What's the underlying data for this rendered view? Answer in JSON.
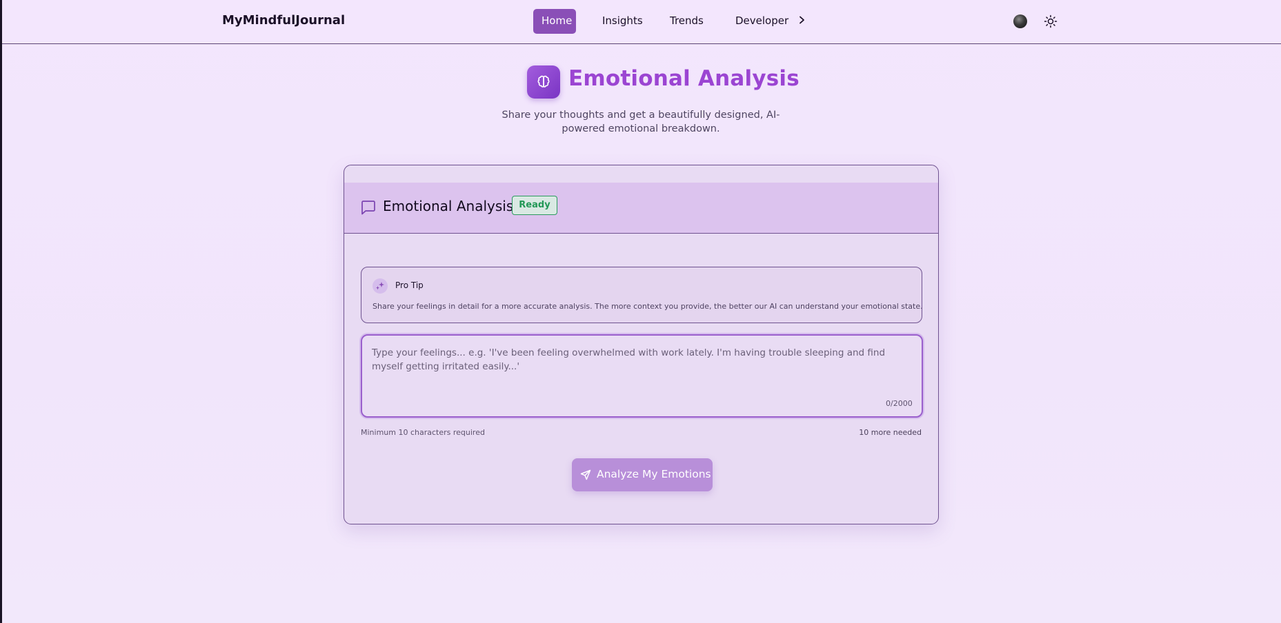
{
  "colors": {
    "accent": "#8a4fb7",
    "title_purple": "#9b45d2",
    "ready_green": "#239857",
    "button_disabled": "#b88fd9"
  },
  "nav": {
    "brand": "MyMindfulJournal",
    "links": [
      {
        "label": "Home",
        "active": true
      },
      {
        "label": "Insights",
        "active": false
      },
      {
        "label": "Trends",
        "active": false
      },
      {
        "label": "Developer",
        "active": false
      }
    ],
    "developer_chevron": "chevron-right-icon",
    "avatar_icon": "avatar-icon",
    "theme_icon": "sun-icon"
  },
  "hero": {
    "icon": "brain-icon",
    "title": "Emotional Analysis",
    "subtitle": "Share your thoughts and get a beautifully designed, AI-powered emotional breakdown."
  },
  "card": {
    "icon": "message-square-icon",
    "title": "Emotional Analysis",
    "status": "Ready",
    "tip": {
      "icon": "sparkles-icon",
      "title": "Pro Tip",
      "text": "Share your feelings in detail for a more accurate analysis. The more context you provide, the better our AI can understand your emotional state."
    },
    "input": {
      "value": "",
      "placeholder": "Type your feelings... e.g. 'I've been feeling overwhelmed with work lately. I'm having trouble sleeping and find myself getting irritated easily...'",
      "char_count": "0/2000"
    },
    "min_note": "Minimum 10 characters required",
    "needed_note": "10 more needed",
    "button": {
      "icon": "send-icon",
      "label": "Analyze My Emotions"
    }
  }
}
